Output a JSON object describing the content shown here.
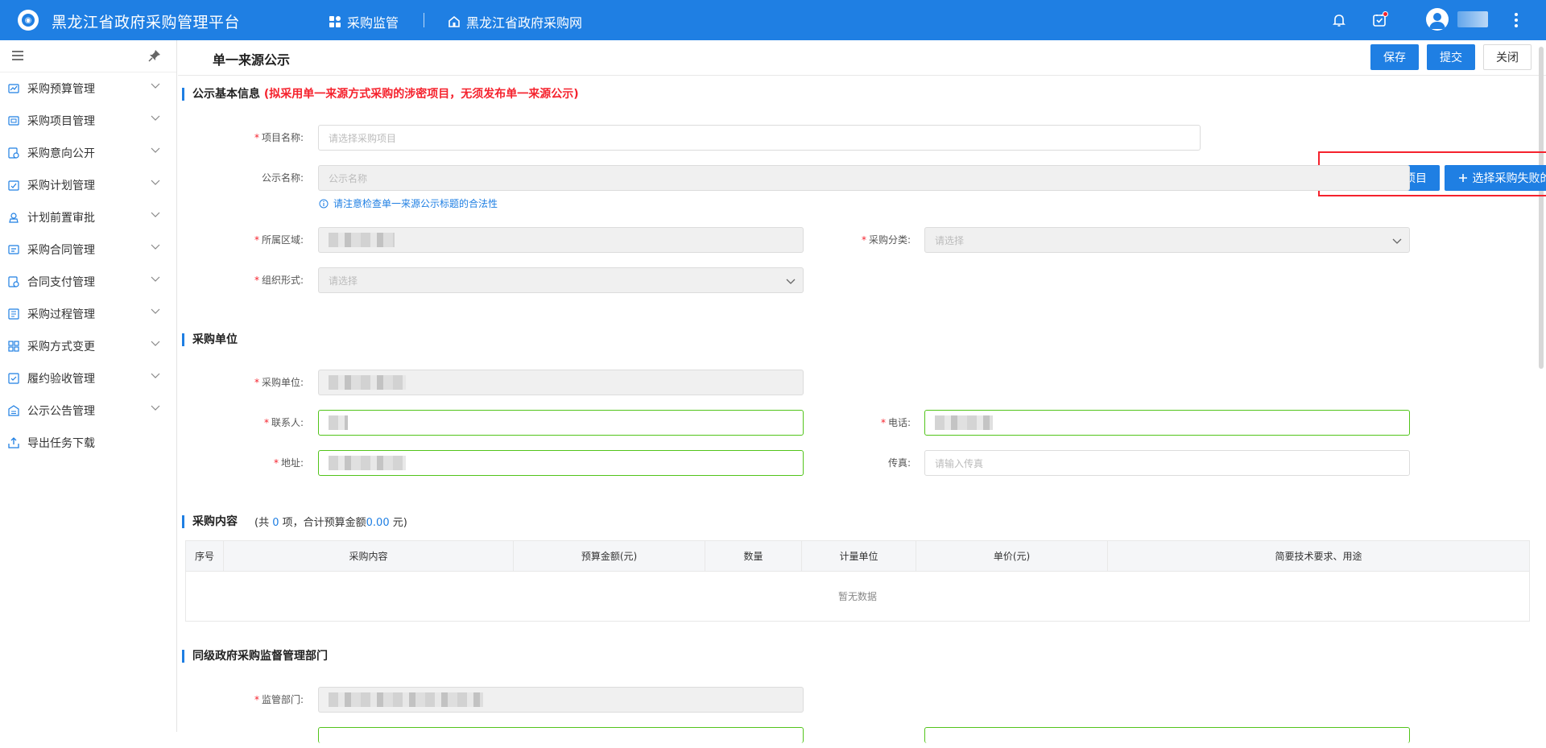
{
  "app": {
    "title": "黑龙江省政府采购管理平台"
  },
  "topnav": {
    "supervision": "采购监管",
    "website": "黑龙江省政府采购网"
  },
  "sidebar": {
    "items": [
      {
        "label": "采购预算管理",
        "icon": "budget-icon"
      },
      {
        "label": "采购项目管理",
        "icon": "project-icon"
      },
      {
        "label": "采购意向公开",
        "icon": "intent-icon"
      },
      {
        "label": "采购计划管理",
        "icon": "plan-icon"
      },
      {
        "label": "计划前置审批",
        "icon": "approval-icon"
      },
      {
        "label": "采购合同管理",
        "icon": "contract-icon"
      },
      {
        "label": "合同支付管理",
        "icon": "payment-icon"
      },
      {
        "label": "采购过程管理",
        "icon": "process-icon"
      },
      {
        "label": "采购方式变更",
        "icon": "method-change-icon"
      },
      {
        "label": "履约验收管理",
        "icon": "acceptance-icon"
      },
      {
        "label": "公示公告管理",
        "icon": "announcement-icon"
      },
      {
        "label": "导出任务下载",
        "icon": "export-icon"
      }
    ]
  },
  "page": {
    "title": "单一来源公示"
  },
  "actions": {
    "save": "保存",
    "submit": "提交",
    "close": "关闭"
  },
  "basic_info": {
    "title": "公示基本信息",
    "warning": "(拟采用单一来源方式采购的涉密项目，无须发布单一来源公示)",
    "project_name_label": "项目名称:",
    "project_name_placeholder": "请选择采购项目",
    "select_project_button": "选择采购项目",
    "select_failed_project_button": "选择采购失败的项目",
    "notice_name_label": "公示名称:",
    "notice_name_placeholder": "公示名称",
    "notice_hint": "请注意检查单一来源公示标题的合法性",
    "region_label": "所属区域:",
    "category_label": "采购分类:",
    "category_placeholder": "请选择",
    "org_form_label": "组织形式:",
    "org_form_placeholder": "请选择"
  },
  "buyer": {
    "title": "采购单位",
    "unit_label": "采购单位:",
    "contact_label": "联系人:",
    "phone_label": "电话:",
    "address_label": "地址:",
    "fax_label": "传真:",
    "fax_placeholder": "请输入传真"
  },
  "content": {
    "title": "采购内容",
    "summary_prefix": "(共",
    "count": "0",
    "summary_mid": "项，合计预算金额",
    "amount": "0.00",
    "summary_suffix": "元)",
    "columns": [
      "序号",
      "采购内容",
      "预算金额(元)",
      "数量",
      "计量单位",
      "单价(元)",
      "简要技术要求、用途"
    ],
    "empty_text": "暂无数据"
  },
  "supervisor": {
    "title": "同级政府采购监督管理部门",
    "dept_label": "监管部门:"
  }
}
